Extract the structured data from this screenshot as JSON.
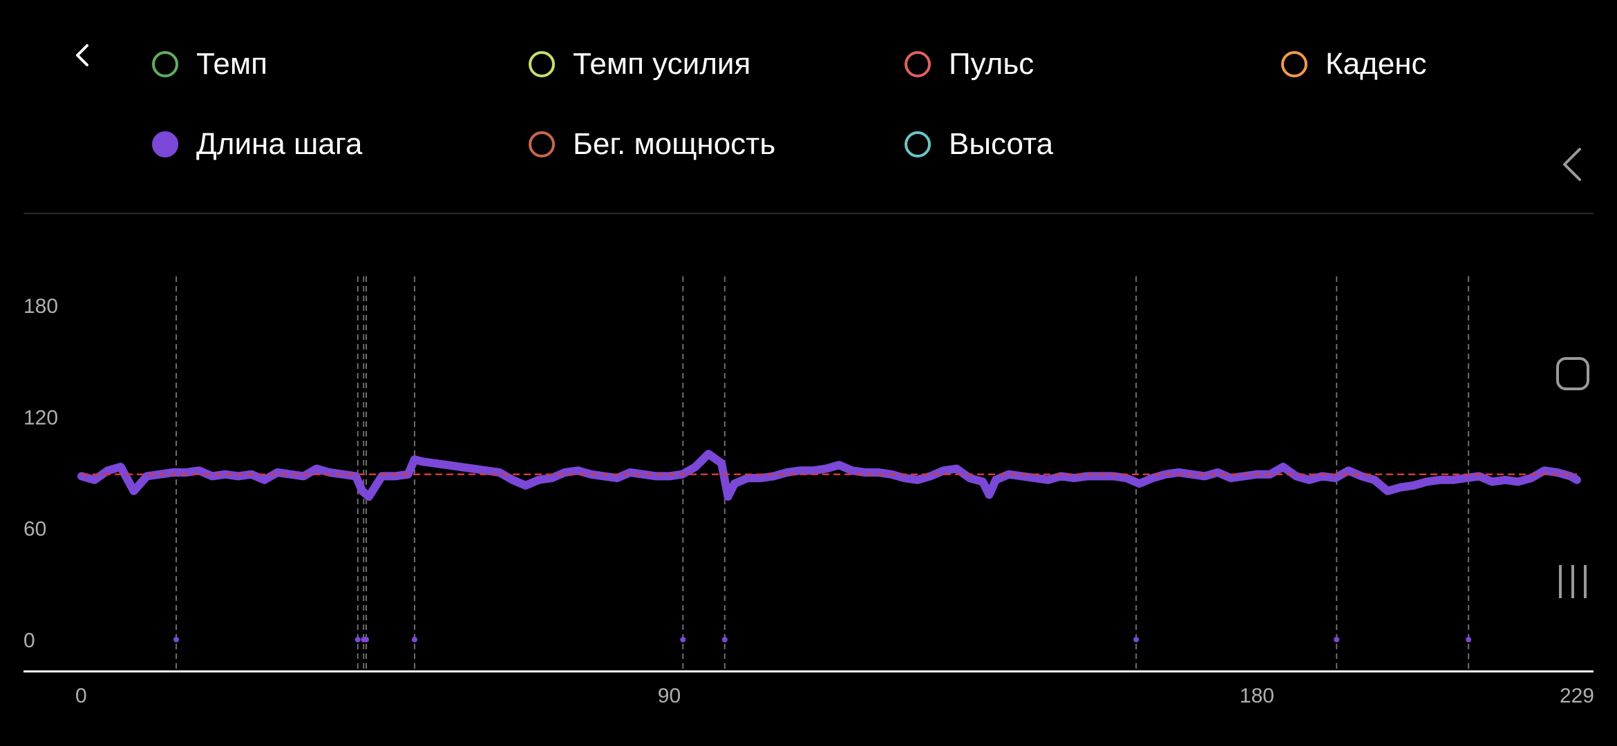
{
  "legend": {
    "items": [
      {
        "name": "legend-pace",
        "label": "Темп",
        "color": "#5fae5f",
        "active": false
      },
      {
        "name": "legend-effort-pace",
        "label": "Темп усилия",
        "color": "#c4e06a",
        "active": false
      },
      {
        "name": "legend-heart-rate",
        "label": "Пульс",
        "color": "#e0615d",
        "active": false
      },
      {
        "name": "legend-cadence",
        "label": "Каденс",
        "color": "#f19a4a",
        "active": false
      },
      {
        "name": "legend-stride-length",
        "label": "Длина шага",
        "color": "#7b48d8",
        "active": true
      },
      {
        "name": "legend-running-power",
        "label": "Бег. мощность",
        "color": "#c9684a",
        "active": false
      },
      {
        "name": "legend-altitude",
        "label": "Высота",
        "color": "#6cc6c8",
        "active": false
      }
    ]
  },
  "icons": {
    "back": "back-chevron-icon",
    "side_back": "side-back-chevron-icon",
    "home": "home-square-icon",
    "recents": "recents-bars-icon"
  },
  "chart_data": {
    "type": "scatter",
    "xlim": [
      0,
      229
    ],
    "ylim": [
      0,
      180
    ],
    "x_ticks": [
      "0",
      "90",
      "180",
      "229"
    ],
    "y_ticks": [
      "0",
      "60",
      "120",
      "180"
    ],
    "series_color": "#7b48d8",
    "average_line": {
      "y": 89,
      "color": "#d33a3a",
      "style": "dashed"
    },
    "pause_markers_x": [
      14.5,
      42.3,
      43.2,
      43.6,
      51.0,
      92.1,
      98.5,
      161.5,
      192.2,
      212.4
    ],
    "series": [
      {
        "values_xy": [
          [
            0,
            88
          ],
          [
            2,
            86
          ],
          [
            4,
            91
          ],
          [
            6,
            93
          ],
          [
            8,
            80
          ],
          [
            10,
            88
          ],
          [
            12,
            89
          ],
          [
            14,
            90
          ],
          [
            16,
            90
          ],
          [
            18,
            91
          ],
          [
            20,
            88
          ],
          [
            22,
            89
          ],
          [
            24,
            88
          ],
          [
            26,
            89
          ],
          [
            28,
            86
          ],
          [
            30,
            90
          ],
          [
            32,
            89
          ],
          [
            34,
            88
          ],
          [
            36,
            92
          ],
          [
            38,
            90
          ],
          [
            40,
            89
          ],
          [
            42,
            88
          ],
          [
            43,
            80
          ],
          [
            44,
            77
          ],
          [
            46,
            88
          ],
          [
            48,
            88
          ],
          [
            50,
            89
          ],
          [
            51,
            97
          ],
          [
            52,
            96
          ],
          [
            54,
            95
          ],
          [
            56,
            94
          ],
          [
            58,
            93
          ],
          [
            60,
            92
          ],
          [
            62,
            91
          ],
          [
            64,
            90
          ],
          [
            66,
            86
          ],
          [
            68,
            83
          ],
          [
            70,
            86
          ],
          [
            72,
            87
          ],
          [
            74,
            90
          ],
          [
            76,
            91
          ],
          [
            78,
            89
          ],
          [
            80,
            88
          ],
          [
            82,
            87
          ],
          [
            84,
            90
          ],
          [
            86,
            89
          ],
          [
            88,
            88
          ],
          [
            90,
            88
          ],
          [
            92,
            89
          ],
          [
            94,
            93
          ],
          [
            96,
            100
          ],
          [
            98,
            95
          ],
          [
            99,
            77
          ],
          [
            100,
            84
          ],
          [
            102,
            87
          ],
          [
            104,
            87
          ],
          [
            106,
            88
          ],
          [
            108,
            90
          ],
          [
            110,
            91
          ],
          [
            112,
            91
          ],
          [
            114,
            92
          ],
          [
            116,
            94
          ],
          [
            118,
            91
          ],
          [
            120,
            90
          ],
          [
            122,
            90
          ],
          [
            124,
            89
          ],
          [
            126,
            87
          ],
          [
            128,
            86
          ],
          [
            130,
            88
          ],
          [
            132,
            91
          ],
          [
            134,
            92
          ],
          [
            136,
            87
          ],
          [
            138,
            85
          ],
          [
            139,
            78
          ],
          [
            140,
            86
          ],
          [
            142,
            89
          ],
          [
            144,
            88
          ],
          [
            146,
            87
          ],
          [
            148,
            86
          ],
          [
            150,
            88
          ],
          [
            152,
            87
          ],
          [
            154,
            88
          ],
          [
            156,
            88
          ],
          [
            158,
            88
          ],
          [
            160,
            87
          ],
          [
            162,
            84
          ],
          [
            164,
            87
          ],
          [
            166,
            89
          ],
          [
            168,
            90
          ],
          [
            170,
            89
          ],
          [
            172,
            88
          ],
          [
            174,
            90
          ],
          [
            176,
            87
          ],
          [
            178,
            88
          ],
          [
            180,
            89
          ],
          [
            182,
            89
          ],
          [
            184,
            93
          ],
          [
            186,
            88
          ],
          [
            188,
            86
          ],
          [
            190,
            88
          ],
          [
            192,
            87
          ],
          [
            194,
            91
          ],
          [
            196,
            88
          ],
          [
            198,
            86
          ],
          [
            200,
            80
          ],
          [
            202,
            82
          ],
          [
            204,
            83
          ],
          [
            206,
            85
          ],
          [
            208,
            86
          ],
          [
            210,
            86
          ],
          [
            212,
            87
          ],
          [
            214,
            88
          ],
          [
            216,
            85
          ],
          [
            218,
            86
          ],
          [
            220,
            85
          ],
          [
            222,
            87
          ],
          [
            224,
            91
          ],
          [
            226,
            90
          ],
          [
            228,
            88
          ],
          [
            229,
            86
          ]
        ]
      }
    ]
  }
}
